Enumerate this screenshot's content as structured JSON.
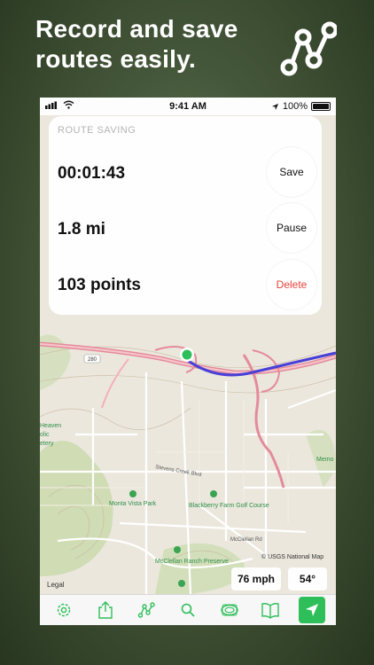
{
  "promo": {
    "title": "Record and save routes easily.",
    "icon": "route-share-icon"
  },
  "status_bar": {
    "time": "9:41 AM",
    "battery": "100%"
  },
  "route_card": {
    "header": "ROUTE SAVING",
    "rows": [
      {
        "value": "00:01:43",
        "action": "Save"
      },
      {
        "value": "1.8 mi",
        "action": "Pause"
      },
      {
        "value": "103 points",
        "action": "Delete"
      }
    ]
  },
  "map": {
    "labels": {
      "highway": "280",
      "park1": "Monta Vista Park",
      "park2": "Blackberry Farm Golf Course",
      "park3": "McClellan Ranch Preserve",
      "street1": "Stevens Creek Blvd",
      "street2": "McClellan Rd",
      "heaven1": "Heaven",
      "heaven2": "olic",
      "heaven3": "etery",
      "memo": "Memo"
    },
    "attribution": "© USGS National Map",
    "legal": "Legal",
    "speed": "76 mph",
    "temperature": "54°"
  },
  "tab_bar": {
    "items": [
      "settings-icon",
      "share-icon",
      "route-icon",
      "search-icon",
      "map-layers-icon",
      "book-icon",
      "location-arrow-icon"
    ]
  },
  "colors": {
    "accent": "#2fbf5a",
    "delete": "#e8423a",
    "route_line": "#4a3fd6"
  }
}
